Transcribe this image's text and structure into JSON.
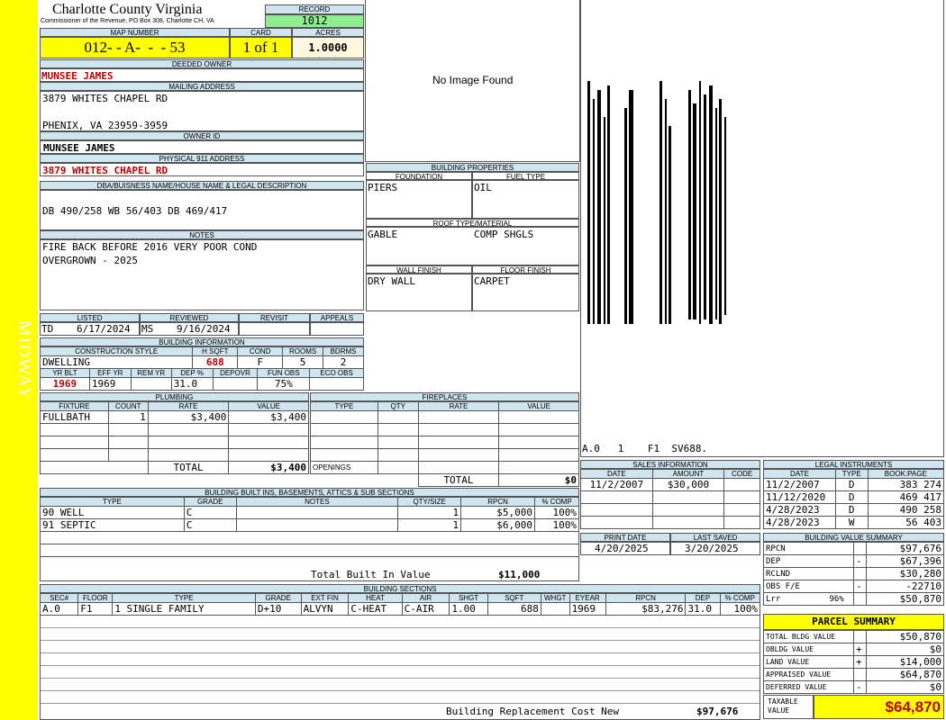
{
  "side_label": "MIDWAY",
  "county": {
    "title": "Charlotte County Virginia",
    "subtitle": "Commissioner of the Revenue, PO Box 308, Charlotte CH, VA"
  },
  "record": {
    "label": "RECORD",
    "value": "1012"
  },
  "map_number": {
    "label": "MAP NUMBER",
    "value": "012- - A-  -  - 53"
  },
  "card": {
    "label": "CARD",
    "value": "1 of 1"
  },
  "acres": {
    "label": "ACRES",
    "value": "1.0000"
  },
  "deeded_owner": {
    "label": "DEEDED OWNER",
    "value": "MUNSEE JAMES"
  },
  "mailing_address": {
    "label": "MAILING ADDRESS",
    "line1": "3879 WHITES CHAPEL RD",
    "line2": "PHENIX, VA 23959-3959"
  },
  "owner_id": {
    "label": "OWNER ID",
    "value": "MUNSEE JAMES"
  },
  "physical_address": {
    "label": "PHYSICAL 911 ADDRESS",
    "value": "3879 WHITES CHAPEL RD"
  },
  "legal_desc": {
    "label": "DBA/BUISNESS NAME/HOUSE NAME & LEGAL DESCRIPTION",
    "value": "DB 490/258 WB 56/403 DB 469/417"
  },
  "notes": {
    "label": "NOTES",
    "line1": "FIRE BACK BEFORE 2016 VERY POOR COND",
    "line2": "OVERGROWN - 2025"
  },
  "image": {
    "placeholder": "No Image Found"
  },
  "sketch_label": "A.0   1    F1  SV688.",
  "building_properties": {
    "label": "BUILDING PROPERTIES",
    "foundation_label": "FOUNDATION",
    "foundation": "PIERS",
    "fuel_label": "FUEL TYPE",
    "fuel": "OIL",
    "roof_label": "ROOF TYPE/MATERIAL",
    "roof_type": "GABLE",
    "roof_material": "COMP SHGLS",
    "wall_label": "WALL FINISH",
    "wall": "DRY WALL",
    "floor_label": "FLOOR FINISH",
    "floor": "CARPET"
  },
  "review": {
    "listed_label": "LISTED",
    "listed_code": "TD",
    "listed_date": "6/17/2024",
    "reviewed_label": "REVIEWED",
    "reviewed_code": "MS",
    "reviewed_date": "9/16/2024",
    "revisit_label": "REVISIT",
    "revisit": "",
    "appeals_label": "APPEALS",
    "appeals": ""
  },
  "building_info": {
    "label": "BUILDING INFORMATION",
    "style_label": "CONSTRUCTION STYLE",
    "style": "DWELLING",
    "hsqft_label": "H SQFT",
    "hsqft": "688",
    "cond_label": "COND",
    "cond": "F",
    "rooms_label": "ROOMS",
    "rooms": "5",
    "bdrms_label": "BDRMS",
    "bdrms": "2",
    "yrblt_label": "YR BLT",
    "yrblt": "1969",
    "effyr_label": "EFF YR",
    "effyr": "1969",
    "remyr_label": "REM YR",
    "remyr": "",
    "dep_label": "DEP %",
    "dep": "31.0",
    "depovr_label": "DEPOVR",
    "depovr": "",
    "funobs_label": "FUN OBS",
    "funobs": "75%",
    "ecoobs_label": "ECO OBS",
    "ecoobs": ""
  },
  "plumbing": {
    "label": "PLUMBING",
    "headers": [
      "FIXTURE",
      "COUNT",
      "RATE",
      "VALUE"
    ],
    "rows": [
      [
        "FULLBATH",
        "1",
        "$3,400",
        "$3,400"
      ]
    ],
    "total_label": "TOTAL",
    "total": "$3,400"
  },
  "fireplaces": {
    "label": "FIREPLACES",
    "headers": [
      "TYPE",
      "QTY",
      "RATE",
      "VALUE"
    ],
    "openings_label": "OPENINGS",
    "total_label": "TOTAL",
    "total": "$0"
  },
  "sales": {
    "label": "SALES INFORMATION",
    "headers": [
      "DATE",
      "AMOUNT",
      "CODE"
    ],
    "rows": [
      [
        "11/2/2007",
        "$30,000",
        ""
      ]
    ]
  },
  "legal_instruments": {
    "label": "LEGAL INSTRUMENTS",
    "headers": [
      "DATE",
      "TYPE",
      "BOOK:PAGE"
    ],
    "rows": [
      [
        "11/2/2007",
        "D",
        "383 274"
      ],
      [
        "11/12/2020",
        "D",
        "469 417"
      ],
      [
        "4/28/2023",
        "D",
        "490 258"
      ],
      [
        "4/28/2023",
        "W",
        "56 403"
      ]
    ]
  },
  "print": {
    "print_label": "PRINT DATE",
    "print_date": "4/20/2025",
    "saved_label": "LAST SAVED",
    "saved_date": "3/20/2025"
  },
  "built_ins": {
    "label": "BUILDING BUILT INS, BASEMENTS, ATTICS & SUB SECTIONS",
    "headers": [
      "TYPE",
      "GRADE",
      "NOTES",
      "QTY/SIZE",
      "RPCN",
      "% COMP"
    ],
    "rows": [
      [
        "90 WELL",
        "C",
        "",
        "1",
        "$5,000",
        "100%"
      ],
      [
        "91 SEPTIC",
        "C",
        "",
        "1",
        "$6,000",
        "100%"
      ]
    ],
    "total_label": "Total Built In Value",
    "total": "$11,000"
  },
  "building_value_summary": {
    "label": "BUILDING VALUE SUMMARY",
    "rows": [
      [
        "RPCN",
        "",
        "$97,676"
      ],
      [
        "DEP",
        "-",
        "$67,396"
      ],
      [
        "RCLND",
        "",
        "$30,280"
      ],
      [
        "OBS F/E",
        "-",
        "-22710"
      ],
      [
        "Lrr          96%",
        "",
        "$50,870"
      ]
    ]
  },
  "building_sections": {
    "label": "BUILDING SECTIONS",
    "headers": [
      "SEC#",
      "FLOOR",
      "TYPE",
      "GRADE",
      "EXT FIN",
      "HEAT",
      "AIR",
      "SHGT",
      "SQFT",
      "WHGT",
      "EYEAR",
      "RPCN",
      "DEP",
      "% COMP"
    ],
    "rows": [
      [
        "A.0",
        "F1",
        "1 SINGLE FAMILY",
        "D+10",
        "ALVYN",
        "C-HEAT",
        "C-AIR",
        "1.00",
        "688",
        "",
        "1969",
        "$83,276",
        "31.0",
        "100%"
      ]
    ],
    "total_label": "Building Replacement Cost New",
    "total": "$97,676"
  },
  "parcel_summary": {
    "label": "PARCEL SUMMARY",
    "rows": [
      [
        "TOTAL BLDG VALUE",
        "",
        "$50,870"
      ],
      [
        "OBLDG VALUE",
        "+",
        "$0"
      ],
      [
        "LAND VALUE",
        "+",
        "$14,000"
      ],
      [
        "APPRAISED VALUE",
        "",
        "$64,870"
      ],
      [
        "DEFERRED VALUE",
        "-",
        "$0"
      ]
    ],
    "taxable_label": "TAXABLE VALUE",
    "taxable": "$64,870"
  }
}
